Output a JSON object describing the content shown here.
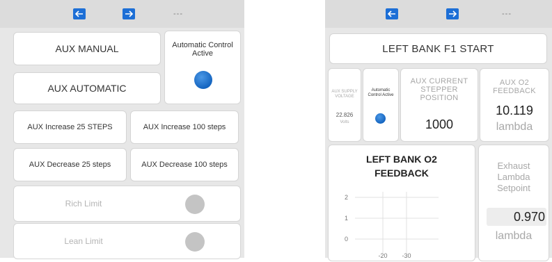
{
  "left_panel": {
    "toolbar": {
      "dash": "---"
    },
    "aux_manual": "AUX MANUAL",
    "aux_automatic": "AUX AUTOMATIC",
    "auto_status_label": "Automatic Control Active",
    "increase_25": "AUX Increase 25 STEPS",
    "increase_100": "AUX Increase 100 steps",
    "decrease_25": "AUX Decrease 25 steps",
    "decrease_100": "AUX Decrease 100 steps",
    "rich_limit": "Rich Limit",
    "lean_limit": "Lean Limit"
  },
  "right_panel": {
    "toolbar": {
      "dash": "---"
    },
    "start_button": "LEFT BANK F1 START",
    "supply_voltage_label": "AUX SUPPLY VOLTAGE",
    "supply_voltage_value": "22.826",
    "supply_voltage_unit": "Volts",
    "auto_active_label": "Automatic Control Active",
    "stepper_label": "AUX CURRENT STEPPER POSITION",
    "stepper_value": "1000",
    "o2_feedback_label": "AUX O2 FEEDBACK",
    "o2_feedback_value": "10.119",
    "o2_feedback_unit": "lambda",
    "chart_title": "LEFT BANK O2 FEEDBACK",
    "setpoint_label": "Exhaust Lambda Setpoint",
    "setpoint_value": "0.970",
    "setpoint_unit": "lambda"
  },
  "colors": {
    "accent": "#1d6fd6",
    "led_on": "#1565c0",
    "led_off": "#c4c4c4"
  },
  "chart_data": {
    "type": "line",
    "title": "LEFT BANK O2 FEEDBACK",
    "y_ticks": [
      "2",
      "1",
      "0"
    ],
    "x_ticks": [
      "-20",
      "-30"
    ],
    "series": []
  }
}
